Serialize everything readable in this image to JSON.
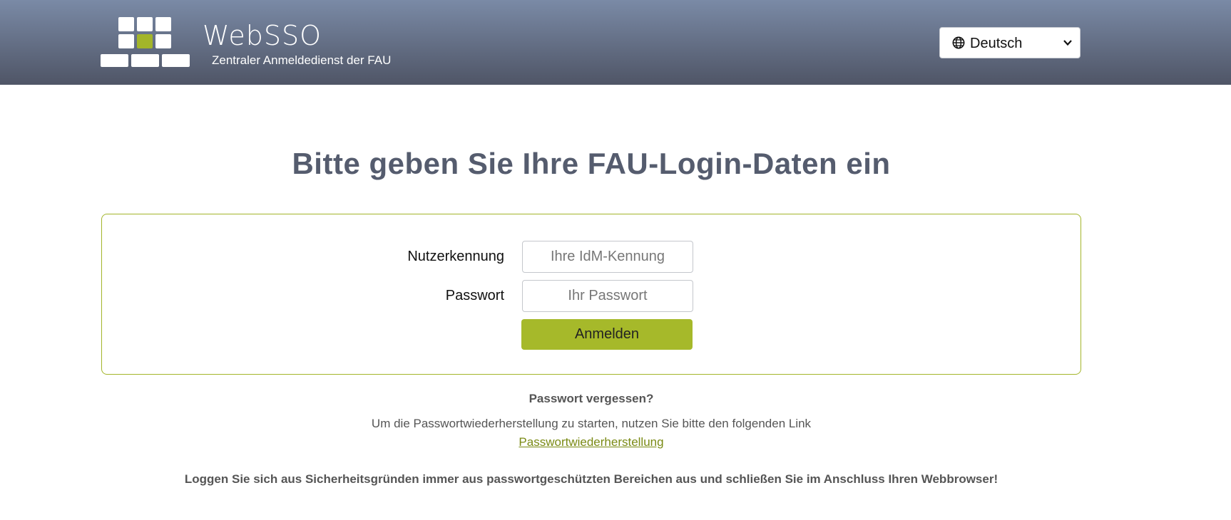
{
  "header": {
    "brand": "WebSSO",
    "subtitle": "Zentraler Anmeldedienst der FAU",
    "language": "Deutsch"
  },
  "main": {
    "title": "Bitte geben Sie Ihre FAU-Login-Daten ein",
    "form": {
      "username_label": "Nutzerkennung",
      "username_placeholder": "Ihre IdM-Kennung",
      "password_label": "Passwort",
      "password_placeholder": "Ihr Passwort",
      "submit_label": "Anmelden"
    },
    "forgot": {
      "question": "Passwort vergessen?",
      "info": "Um die Passwortwiederherstellung zu starten, nutzen Sie bitte den folgenden Link",
      "link": "Passwortwiederherstellung"
    },
    "security_notice": "Loggen Sie sich aus Sicherheitsgründen immer aus passwortgeschützten Bereichen aus und schließen Sie im Anschluss Ihren Webbrowser!"
  },
  "colors": {
    "accent": "#a6b92a",
    "header_top": "#7a8aa6",
    "header_bottom": "#4f5566",
    "title": "#555c6e"
  },
  "icons": [
    "globe-icon",
    "chevron-down-icon",
    "websso-logo"
  ]
}
